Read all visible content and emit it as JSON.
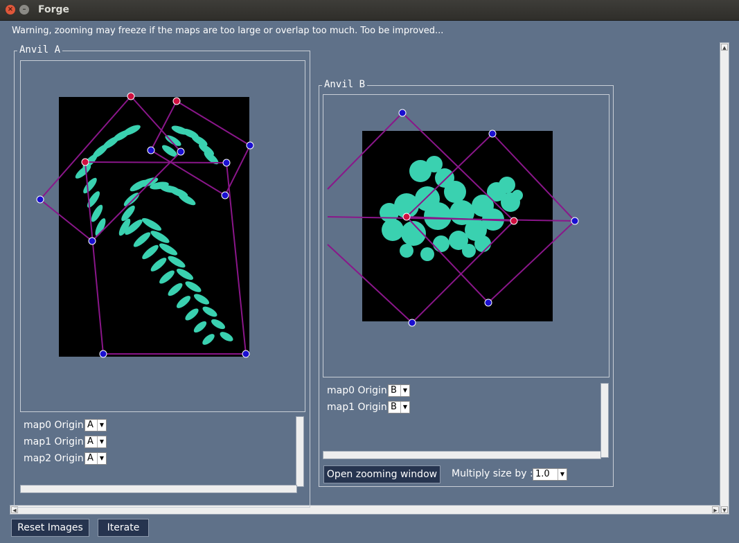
{
  "window": {
    "title": "Forge",
    "close_glyph": "×",
    "minimize_glyph": "–"
  },
  "warning": "Warning, zooming may freeze if the maps are too large or overlap too much. Too be improved...",
  "anvil_a": {
    "title": "Anvil A",
    "maps": [
      {
        "label": "map0 Origin",
        "value": "A"
      },
      {
        "label": "map1 Origin",
        "value": "A"
      },
      {
        "label": "map2 Origin",
        "value": "A"
      }
    ]
  },
  "anvil_b": {
    "title": "Anvil B",
    "maps": [
      {
        "label": "map0 Origin",
        "value": "B"
      },
      {
        "label": "map1 Origin",
        "value": "B"
      }
    ],
    "zoom_button": "Open zooming window",
    "multiply_label": "Multiply size by :",
    "multiply_value": "1.0"
  },
  "buttons": {
    "reset": "Reset Images",
    "iterate": "Iterate"
  },
  "glyphs": {
    "drop": "▼",
    "up": "▲",
    "down": "▼",
    "left": "◀",
    "right": "▶"
  },
  "colors": {
    "background": "#5f7189",
    "fractal": "#3ad1b0",
    "map_lines": "#8a168a",
    "handle_blue": "#1a0fd0",
    "handle_red": "#d01040",
    "button": "#26344f"
  }
}
